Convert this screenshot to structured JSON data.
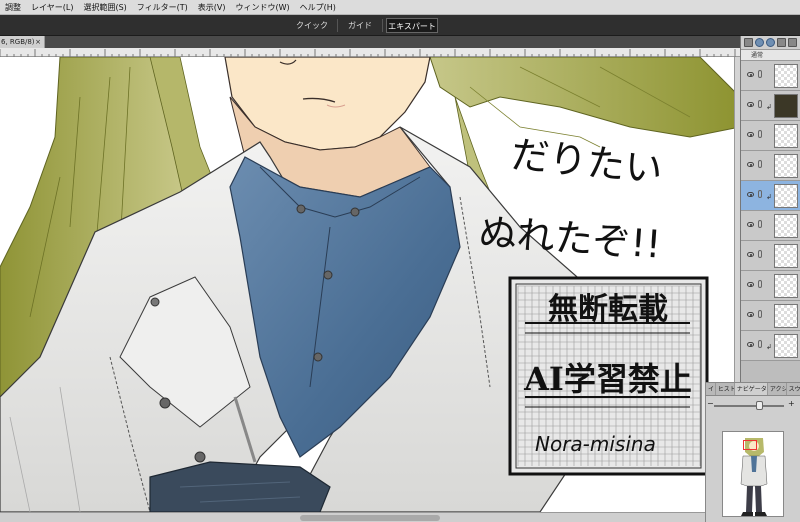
{
  "menu": {
    "items": [
      "調整",
      "レイヤー(L)",
      "選択範囲(S)",
      "フィルター(T)",
      "表示(V)",
      "ウィンドウ(W)",
      "ヘルプ(H)"
    ]
  },
  "modes": {
    "quick": "クイック",
    "guide": "ガイド",
    "expert": "エキスパート"
  },
  "document": {
    "tab_label": "6, RGB/8)",
    "close_glyph": "×"
  },
  "artwork": {
    "handwriting_line1": "だりたい",
    "handwriting_line2": "ぬれたぞ!!",
    "watermark_line1": "無断転載",
    "watermark_line2": "AI学習禁止",
    "signature": "Nora-misina"
  },
  "layers_panel": {
    "blend_mode": "通常",
    "layer_count_visible": 10
  },
  "navigator": {
    "tabs": [
      "イ",
      "ヒスト",
      "ナビゲーター",
      "アクシ",
      "スウ"
    ],
    "active_tab": "ナビゲーター",
    "zoom_minus": "−",
    "zoom_plus": "+",
    "zoom_level": 0.66
  },
  "colors": {
    "selected_layer": "#8db4e0",
    "hair": "#b7b96a",
    "shirt": "#4f7398",
    "jacket": "#e4e4e2"
  }
}
